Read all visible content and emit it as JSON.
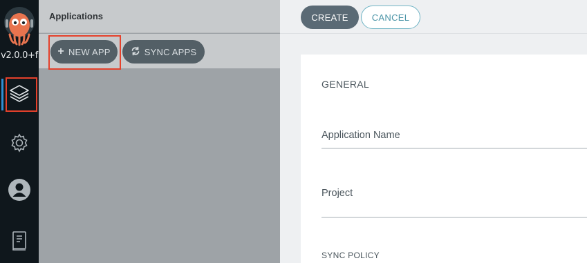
{
  "nav": {
    "version": "v2.0.0+f",
    "items": [
      {
        "name": "applications",
        "icon": "layers-icon"
      },
      {
        "name": "settings",
        "icon": "gear-icon"
      },
      {
        "name": "user-info",
        "icon": "user-icon"
      },
      {
        "name": "documentation",
        "icon": "docs-icon"
      }
    ]
  },
  "apps": {
    "title": "Applications",
    "new_app_label": "NEW APP",
    "sync_apps_label": "SYNC APPS"
  },
  "panel": {
    "create_label": "CREATE",
    "cancel_label": "CANCEL",
    "general_heading": "GENERAL",
    "application_name_label": "Application Name",
    "project_label": "Project",
    "sync_policy_heading": "SYNC POLICY"
  },
  "colors": {
    "highlight": "#e5412b",
    "rail_bg": "#0f171c",
    "accent_teal": "#4c95a8",
    "active_blue": "#2f8fd3"
  }
}
